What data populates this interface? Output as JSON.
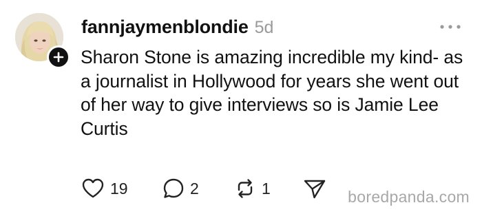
{
  "post": {
    "username": "fannjaymenblondie",
    "timestamp": "5d",
    "text": "Sharon Stone is amazing incredible my kind- as a journalist in Hollywood for years she went out of her way to give interviews so is Jamie Lee Curtis",
    "avatar_icon": "profile-photo",
    "follow_icon": "plus-icon",
    "more_icon": "ellipsis-icon"
  },
  "actions": {
    "like_count": "19",
    "reply_count": "2",
    "repost_count": "1",
    "like_icon": "heart-icon",
    "reply_icon": "speech-bubble-icon",
    "repost_icon": "repost-arrows-icon",
    "share_icon": "paper-plane-icon"
  },
  "watermark": {
    "text": "boredpanda.com"
  },
  "colors": {
    "text": "#111111",
    "muted": "#9a9a9a",
    "icon": "#222222",
    "watermark": "#a8a8a8"
  }
}
